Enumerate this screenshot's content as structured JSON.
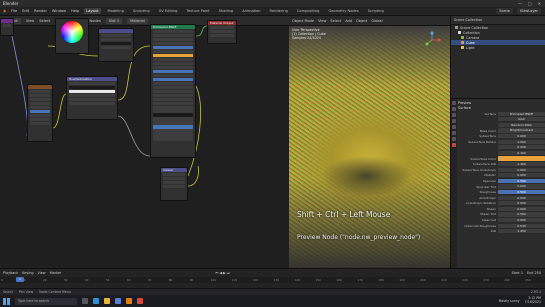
{
  "window": {
    "title": "Blender",
    "controls": [
      "—",
      "□",
      "✕"
    ]
  },
  "menubar": {
    "menus": [
      "File",
      "Edit",
      "Render",
      "Window",
      "Help"
    ],
    "workspace_tabs": [
      "Layout",
      "Modeling",
      "Sculpting",
      "UV Editing",
      "Texture Paint",
      "Shading",
      "Animation",
      "Rendering",
      "Compositing",
      "Geometry Nodes",
      "Scripting"
    ],
    "active_tab": "Layout",
    "scene_field": "Scene",
    "view_layer_field": "ViewLayer"
  },
  "node_editor": {
    "header": [
      "Object",
      "View",
      "Select",
      "Add",
      "Node",
      "Use Nodes",
      "Slot 1",
      "Material"
    ],
    "nodes": [
      {
        "title": "",
        "color": "#6b2f8f"
      },
      {
        "title": "",
        "color": "#4d4d8a"
      },
      {
        "title": "Principled BSDF",
        "color": "#1f7a4b"
      },
      {
        "title": "Material Output",
        "color": "#8e2b2b"
      },
      {
        "title": "Hue/Saturation",
        "color": "#4d4d8a"
      },
      {
        "title": "ColorRamp",
        "color": "#4d4d8a"
      },
      {
        "title": "Viewer",
        "color": "#4d4d8a"
      },
      {
        "title": "",
        "color": "#7a4f2a"
      }
    ]
  },
  "viewport": {
    "header": [
      "Object Mode",
      "View",
      "Select",
      "Add",
      "Object",
      "Global"
    ],
    "info_lines": [
      "User Perspective",
      "(1) Collection | Cube",
      "Samples 24/1024"
    ],
    "overlay_shortcut": "Shift + Ctrl + Left Mouse",
    "overlay_operator": "Preview Node (\"node.nw_preview_node\")"
  },
  "outliner": {
    "header": "Scene Collection",
    "rows": [
      {
        "label": "Scene Collection",
        "selected": false,
        "color": "#9a9a9a"
      },
      {
        "label": "Collection",
        "selected": false,
        "color": "#d9d9d9"
      },
      {
        "label": "Camera",
        "selected": false,
        "color": "#8fb84a"
      },
      {
        "label": "Cube",
        "selected": true,
        "color": "#e39a3b"
      },
      {
        "label": "Light",
        "selected": false,
        "color": "#e3c93b"
      }
    ]
  },
  "properties": {
    "sections": [
      "Preview",
      "Surface"
    ],
    "rows": [
      {
        "label": "Surface",
        "value": "Principled BSDF",
        "style": ""
      },
      {
        "label": "",
        "value": "GGX",
        "style": ""
      },
      {
        "label": "",
        "value": "Random Walk",
        "style": ""
      },
      {
        "label": "Base Color",
        "value": "Bright/Contrast",
        "style": ""
      },
      {
        "label": "Subsurface",
        "value": "0.000",
        "style": ""
      },
      {
        "label": "Subsurface Radius",
        "value": "1.000",
        "style": ""
      },
      {
        "label": "",
        "value": "0.200",
        "style": ""
      },
      {
        "label": "",
        "value": "0.100",
        "style": ""
      },
      {
        "label": "Subsurface Color",
        "value": "",
        "style": "orange"
      },
      {
        "label": "Subsurface IOR",
        "value": "1.400",
        "style": ""
      },
      {
        "label": "Subsurface Anisotropy",
        "value": "0.000",
        "style": ""
      },
      {
        "label": "Metallic",
        "value": "0.000",
        "style": ""
      },
      {
        "label": "Specular",
        "value": "0.500",
        "style": "blue"
      },
      {
        "label": "Specular Tint",
        "value": "0.000",
        "style": ""
      },
      {
        "label": "Roughness",
        "value": "0.500",
        "style": "blue"
      },
      {
        "label": "Anisotropic",
        "value": "0.000",
        "style": ""
      },
      {
        "label": "Anisotropic Rotation",
        "value": "0.000",
        "style": ""
      },
      {
        "label": "Sheen",
        "value": "0.000",
        "style": ""
      },
      {
        "label": "Sheen Tint",
        "value": "0.500",
        "style": ""
      },
      {
        "label": "Clearcoat",
        "value": "0.000",
        "style": ""
      },
      {
        "label": "Clearcoat Roughness",
        "value": "0.030",
        "style": ""
      },
      {
        "label": "IOR",
        "value": "1.450",
        "style": ""
      }
    ]
  },
  "timeline": {
    "header": [
      "Playback",
      "Keying",
      "View",
      "Marker"
    ],
    "start": "Start 1",
    "end": "End 250",
    "current_frame": "1",
    "ticks": [
      "0",
      "10",
      "20",
      "30",
      "40",
      "50",
      "60",
      "70",
      "80",
      "90",
      "100",
      "110",
      "120",
      "130",
      "140",
      "150",
      "160",
      "170",
      "180",
      "190",
      "200",
      "210",
      "220",
      "230",
      "240",
      "250"
    ]
  },
  "statusbar": {
    "items": [
      "Select",
      "Pan View",
      "Node Context Menu"
    ],
    "version": "2.93.1"
  },
  "taskbar": {
    "search_placeholder": "Type here to search",
    "weather": "Mostly sunny",
    "time": "3:12 PM",
    "date": "7/16/2021"
  }
}
